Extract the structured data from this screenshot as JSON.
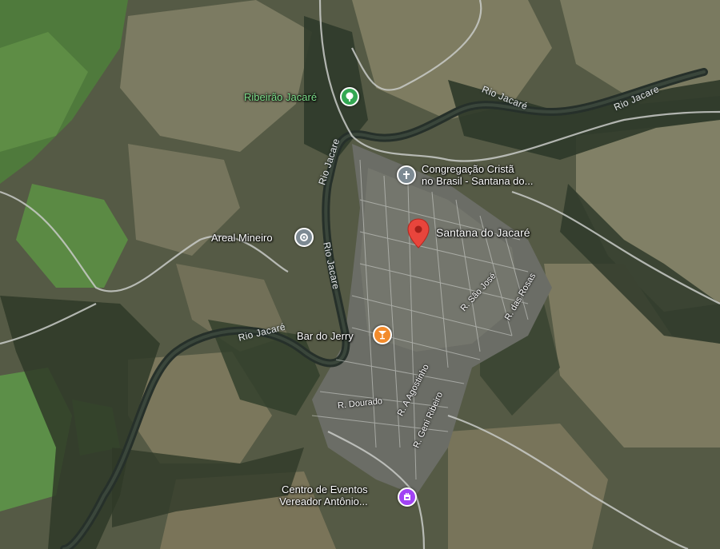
{
  "map": {
    "main_place": "Santana do Jacaré",
    "places": {
      "ribeirao": "Ribeirão Jacaré",
      "congregacao_line1": "Congregação Cristã",
      "congregacao_line2": "no Brasil - Santana do...",
      "areal": "Areal Mineiro",
      "bar": "Bar do Jerry",
      "centro_line1": "Centro de Eventos",
      "centro_line2": "Vereador Antônio..."
    },
    "rivers": {
      "r1": "Rio Jacaré",
      "r2": "Rio Jacare",
      "r3": "Rio Jacare",
      "r4": "Rio Jacare",
      "r5": "Rio Jacaré"
    },
    "streets": {
      "sao_jose": "R. São José",
      "das_rosas": "R. das Rosas",
      "dourado": "R. Dourado",
      "agostinho": "R. A Agostinho",
      "geni": "R. Geni Ribeiro"
    },
    "colors": {
      "pin": "#e8453c",
      "park": "#34a853",
      "bar": "#f28b2c",
      "event": "#a142f4",
      "generic": "#7d8a93",
      "green_label": "#7fe08c"
    },
    "icons": {
      "park": "tree-icon",
      "church": "cross-icon",
      "areal": "location-icon",
      "bar": "cocktail-icon",
      "event": "ticket-icon",
      "pin": "map-pin-icon"
    }
  }
}
